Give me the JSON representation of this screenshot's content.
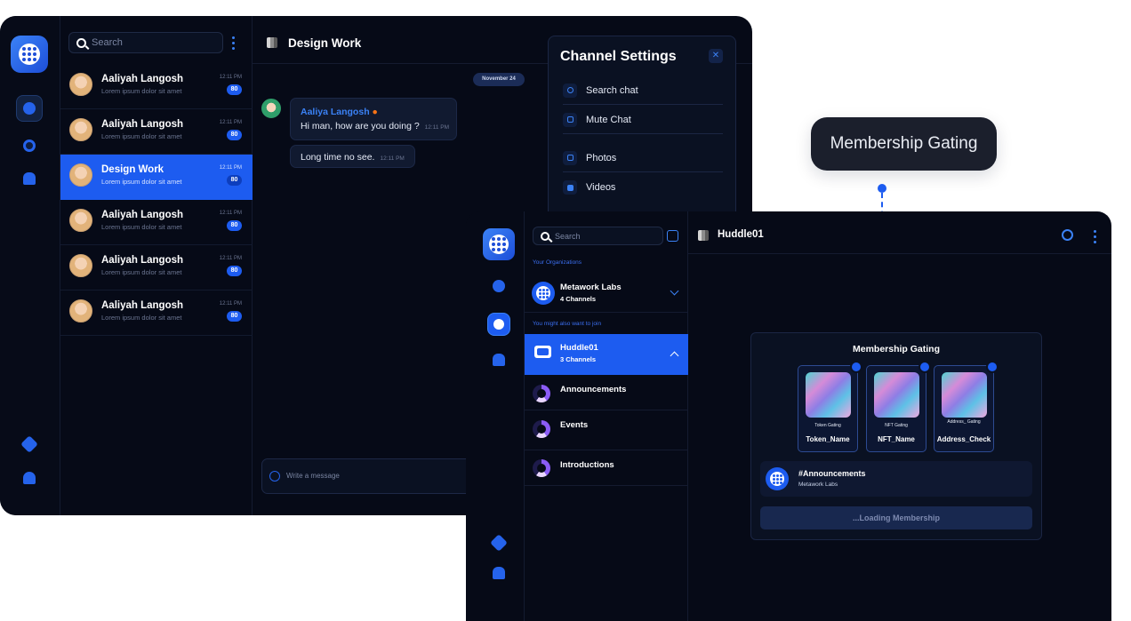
{
  "back_window": {
    "search_placeholder": "Search",
    "chats": [
      {
        "name": "Aaliyah Langosh",
        "preview": "Lorem ipsum dolor sit amet",
        "time": "12:11 PM",
        "badge": "80"
      },
      {
        "name": "Aaliyah Langosh",
        "preview": "Lorem ipsum dolor sit amet",
        "time": "12:11 PM",
        "badge": "80"
      },
      {
        "name": "Design Work",
        "preview": "Lorem ipsum dolor sit amet",
        "time": "12:11 PM",
        "badge": "80"
      },
      {
        "name": "Aaliyah Langosh",
        "preview": "Lorem ipsum dolor sit amet",
        "time": "12:11 PM",
        "badge": "80"
      },
      {
        "name": "Aaliyah Langosh",
        "preview": "Lorem ipsum dolor sit amet",
        "time": "12:11 PM",
        "badge": "80"
      },
      {
        "name": "Aaliyah Langosh",
        "preview": "Lorem ipsum dolor sit amet",
        "time": "12:11 PM",
        "badge": "80"
      }
    ],
    "header_title": "Design Work",
    "date_pill": "November 24",
    "message_sender": "Aaliya Langosh",
    "message_1": "Hi man, how are you doing ?",
    "message_1_time": "12:11 PM",
    "message_2": "Long time no see.",
    "message_2_time": "12:11 PM",
    "composer_placeholder": "Write a message",
    "settings": {
      "title": "Channel Settings",
      "close": "✕",
      "items": [
        "Search chat",
        "Mute Chat",
        "Photos",
        "Videos"
      ]
    }
  },
  "callout": {
    "label": "Membership Gating"
  },
  "front_window": {
    "search_placeholder": "Search",
    "section_orgs": "Your Organizations",
    "org_name": "Metawork Labs",
    "org_channels": "4 Channels",
    "section_suggest": "You might also want to join",
    "huddle_name": "Huddle01",
    "huddle_channels": "3 Channels",
    "channels": [
      "Announcements",
      "Events",
      "Introductions"
    ],
    "header_title": "Huddle01",
    "gating": {
      "title": "Membership Gating",
      "cards": [
        {
          "label": "Token Gating",
          "name": "Token_Name"
        },
        {
          "label": "NFT Gating",
          "name": "NFT_Name"
        },
        {
          "label": "Address_ Gating",
          "name": "Address_Check"
        }
      ],
      "announce_title": "#Announcements",
      "announce_sub": "Metawork Labs",
      "loading": "...Loading Membership"
    }
  },
  "colors": {
    "accent": "#1d5cf0",
    "background": "#060a17",
    "name_highlight": "#3b82f6"
  }
}
